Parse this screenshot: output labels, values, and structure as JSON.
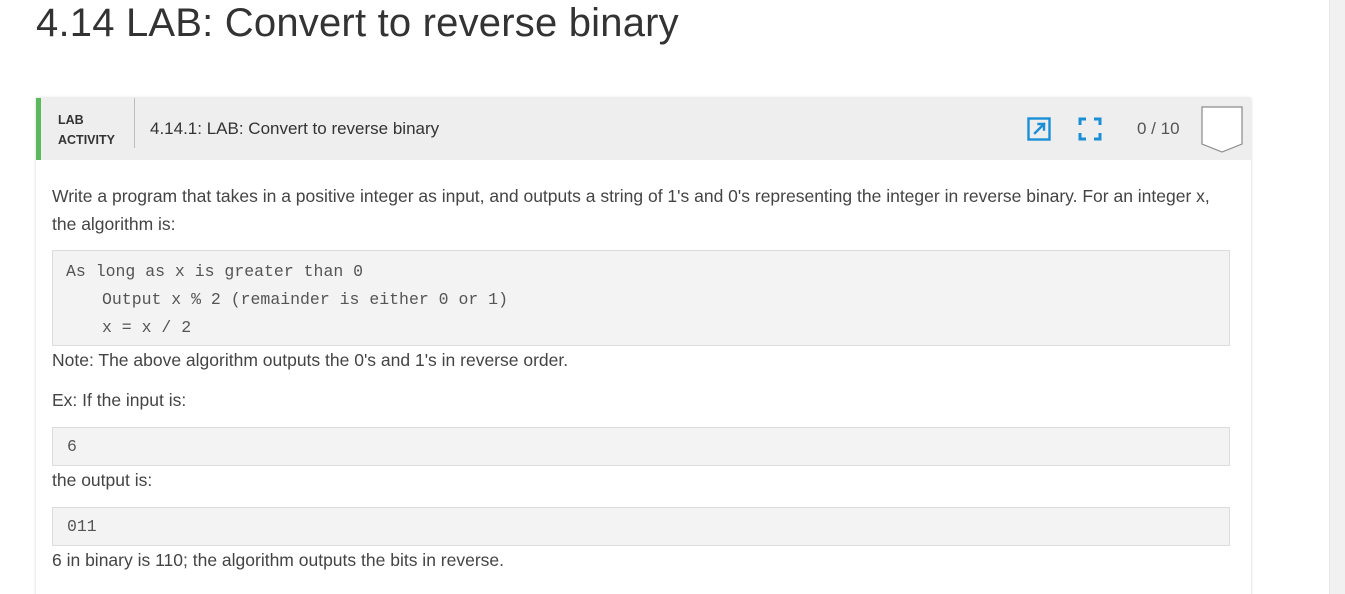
{
  "section": {
    "title": "4.14 LAB: Convert to reverse binary"
  },
  "lab": {
    "kind_line1": "LAB",
    "kind_line2": "ACTIVITY",
    "name": "4.14.1: LAB: Convert to reverse binary",
    "score": "0 / 10",
    "icons": [
      "open-external-icon",
      "fullscreen-icon",
      "score-badge-icon"
    ],
    "accent_color": "#5cb85c",
    "icon_color": "#1a8fd6"
  },
  "instructions": {
    "intro": "Write a program that takes in a positive integer as input, and outputs a string of 1's and 0's representing the integer in reverse binary. For an integer x, the algorithm is:",
    "algorithm": [
      "As long as x is greater than 0",
      "Output x % 2 (remainder is either 0 or 1)",
      "x = x / 2"
    ],
    "note": "Note: The above algorithm outputs the 0's and 1's in reverse order.",
    "input_label": "Ex: If the input is:",
    "input_value": "6",
    "output_label": "the output is:",
    "output_value": "011",
    "explanation": "6 in binary is 110; the algorithm outputs the bits in reverse."
  }
}
